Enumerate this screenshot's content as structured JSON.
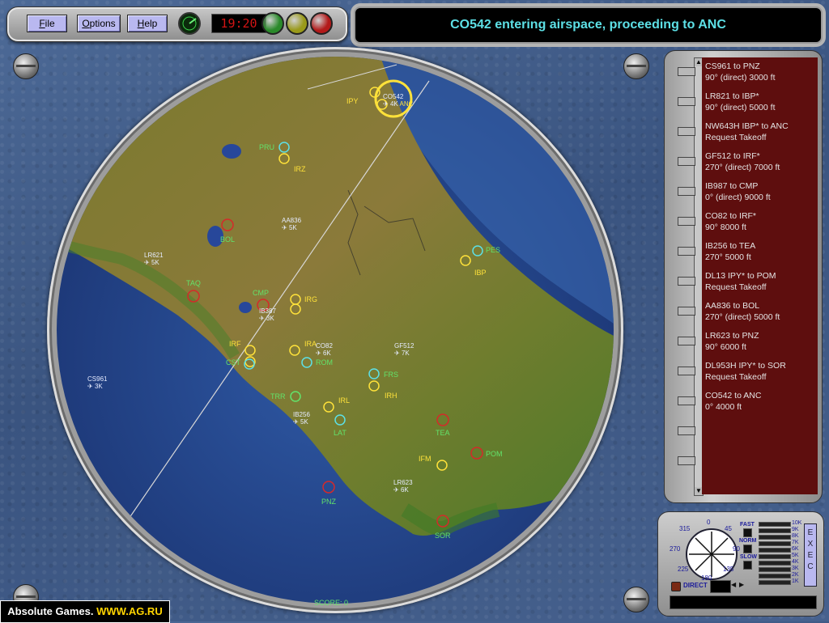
{
  "toolbar": {
    "menus": [
      {
        "label": "File",
        "u": "F",
        "rest": "ile"
      },
      {
        "label": "Options",
        "u": "O",
        "rest": "ptions"
      },
      {
        "label": "Help",
        "u": "H",
        "rest": "elp"
      }
    ],
    "clock": "19:20",
    "lights": [
      "#2a8a2a",
      "#9a9a1a",
      "#b31a1a"
    ]
  },
  "message": "CO542 entering airspace, proceeding to ANC",
  "map": {
    "score": "SCORE: 0",
    "labels": [
      {
        "t": "IPY",
        "c": "#ffe23a"
      },
      {
        "t": "PRU",
        "c": "#62e36b"
      },
      {
        "t": "IRZ",
        "c": "#ffe23a"
      },
      {
        "t": "BOL",
        "c": "#62e36b"
      },
      {
        "t": "PES",
        "c": "#62e36b"
      },
      {
        "t": "IBP",
        "c": "#ffe23a"
      },
      {
        "t": "TAQ",
        "c": "#62e36b"
      },
      {
        "t": "CMP",
        "c": "#62e36b"
      },
      {
        "t": "IRG",
        "c": "#ffe23a"
      },
      {
        "t": "IRF",
        "c": "#ffe23a"
      },
      {
        "t": "CST",
        "c": "#62e36b"
      },
      {
        "t": "IRA",
        "c": "#ffe23a"
      },
      {
        "t": "ROM",
        "c": "#62e36b"
      },
      {
        "t": "FRS",
        "c": "#62e36b"
      },
      {
        "t": "IRH",
        "c": "#ffe23a"
      },
      {
        "t": "TRR",
        "c": "#62e36b"
      },
      {
        "t": "IRL",
        "c": "#ffe23a"
      },
      {
        "t": "LAT",
        "c": "#62e36b"
      },
      {
        "t": "TEA",
        "c": "#62e36b"
      },
      {
        "t": "POM",
        "c": "#62e36b"
      },
      {
        "t": "IFM",
        "c": "#ffe23a"
      },
      {
        "t": "PNZ",
        "c": "#62e36b"
      },
      {
        "t": "SOR",
        "c": "#62e36b"
      }
    ],
    "flights": [
      {
        "id": "CO542",
        "alt": "4K"
      },
      {
        "id": "AA836",
        "alt": "5K"
      },
      {
        "id": "LR621",
        "alt": "5K"
      },
      {
        "id": "IB387",
        "alt": "3K"
      },
      {
        "id": "CO82",
        "alt": "6K"
      },
      {
        "id": "GF512",
        "alt": "7K"
      },
      {
        "id": "CS961",
        "alt": "3K"
      },
      {
        "id": "IB256",
        "alt": "5K"
      },
      {
        "id": "LR623",
        "alt": "6K"
      }
    ],
    "fl_anc": "ANC"
  },
  "strips": [
    {
      "l1": "CS961  to  PNZ",
      "l2": "90°  (direct)   3000 ft"
    },
    {
      "l1": "LR821  to  IBP*",
      "l2": "90°  (direct)   5000 ft"
    },
    {
      "l1": "NW643H  IBP* to ANC",
      "l2": "Request Takeoff"
    },
    {
      "l1": "GF512  to  IRF*",
      "l2": "270°  (direct)   7000 ft"
    },
    {
      "l1": "IB987  to  CMP",
      "l2": "0°  (direct)   9000 ft"
    },
    {
      "l1": "CO82  to  IRF*",
      "l2": "90°    8000 ft"
    },
    {
      "l1": "IB256  to  TEA",
      "l2": "270°    5000 ft"
    },
    {
      "l1": "DL13  IPY* to POM",
      "l2": "Request Takeoff"
    },
    {
      "l1": "AA836  to  BOL",
      "l2": "270°  (direct)   5000 ft"
    },
    {
      "l1": "LR623  to  PNZ",
      "l2": "90°    6000 ft"
    },
    {
      "l1": "DL953H  IPY* to SOR",
      "l2": "Request Takeoff"
    },
    {
      "l1": "CO542  to  ANC",
      "l2": "0°    4000 ft"
    }
  ],
  "control": {
    "headings": [
      "0",
      "45",
      "90",
      "135",
      "180",
      "225",
      "270",
      "315"
    ],
    "speeds": [
      "FAST",
      "NORM",
      "SLOW"
    ],
    "altitudes": [
      "10K",
      "9K",
      "8K",
      "7K",
      "6K",
      "5K",
      "4K",
      "3K",
      "2K",
      "1K"
    ],
    "exec": "EXEC",
    "direct": "DIRECT"
  },
  "watermark": {
    "a": "Absolute Games. ",
    "b": "WWW.AG.RU"
  }
}
